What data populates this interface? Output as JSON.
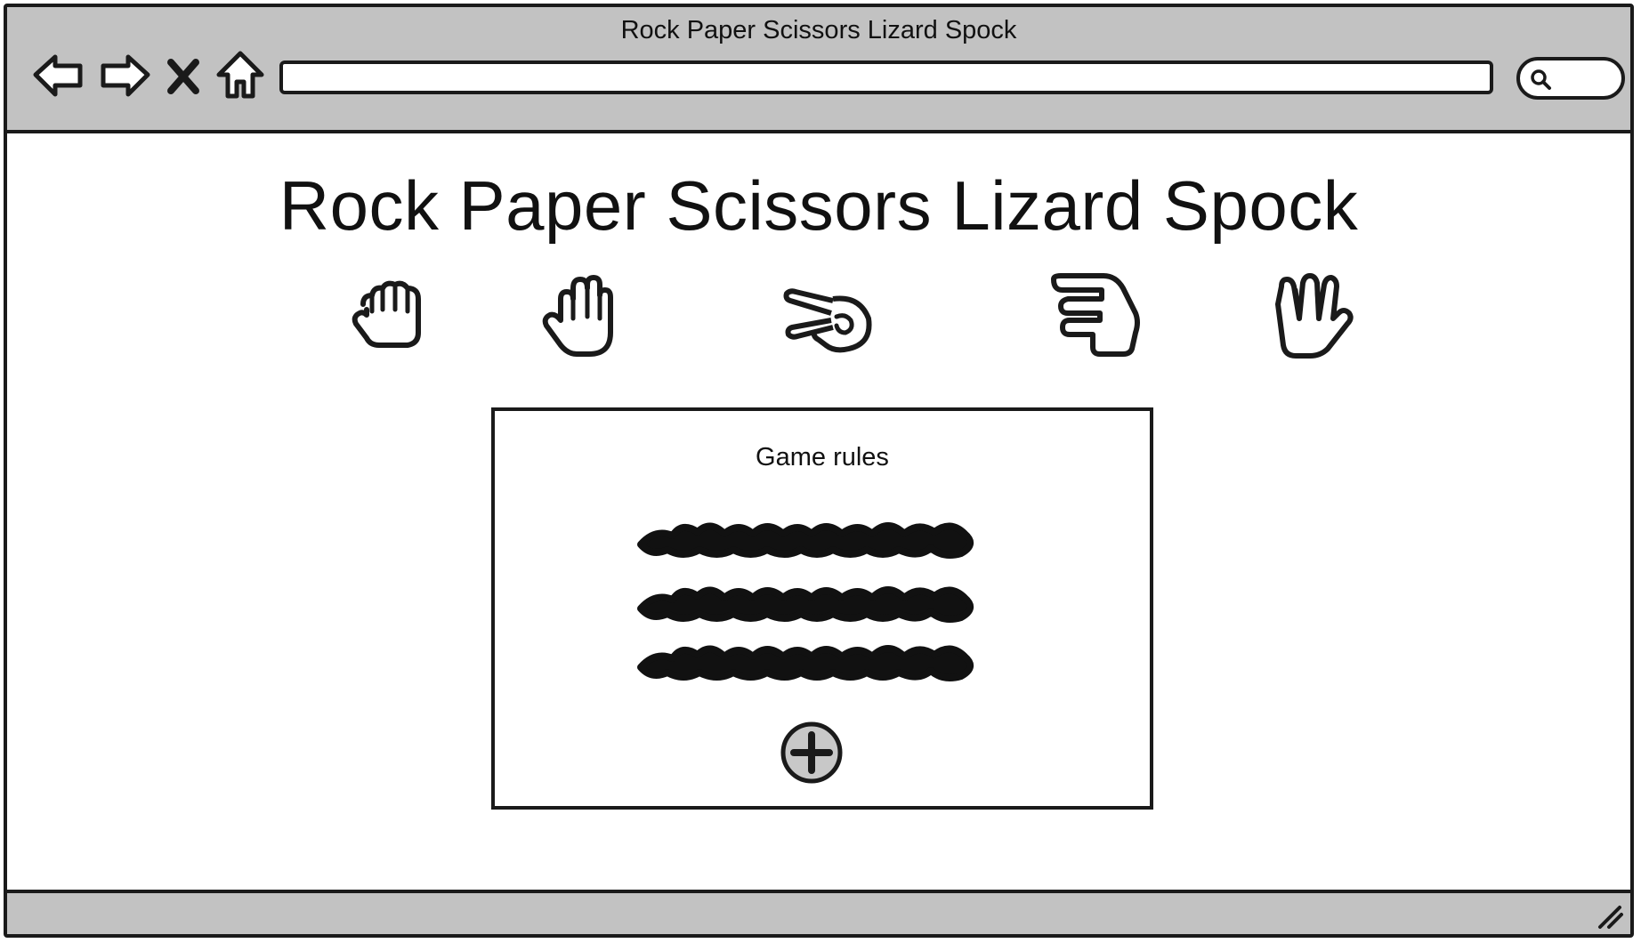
{
  "window": {
    "title": "Rock Paper Scissors Lizard Spock"
  },
  "toolbar": {
    "back_icon": "back-arrow-icon",
    "forward_icon": "forward-arrow-icon",
    "stop_icon": "close-x-icon",
    "home_icon": "home-icon",
    "address_value": "",
    "search_icon": "search-icon"
  },
  "page": {
    "title": "Rock Paper Scissors Lizard Spock",
    "choices": [
      {
        "id": "rock",
        "icon": "rock-hand-icon"
      },
      {
        "id": "paper",
        "icon": "paper-hand-icon"
      },
      {
        "id": "scissors",
        "icon": "scissors-hand-icon"
      },
      {
        "id": "lizard",
        "icon": "lizard-hand-icon"
      },
      {
        "id": "spock",
        "icon": "spock-hand-icon"
      }
    ],
    "rules": {
      "title": "Game rules",
      "expand_icon": "plus-circle-icon"
    }
  },
  "colors": {
    "chrome": "#c2c2c2",
    "ink": "#1a1a1a",
    "background": "#ffffff"
  }
}
